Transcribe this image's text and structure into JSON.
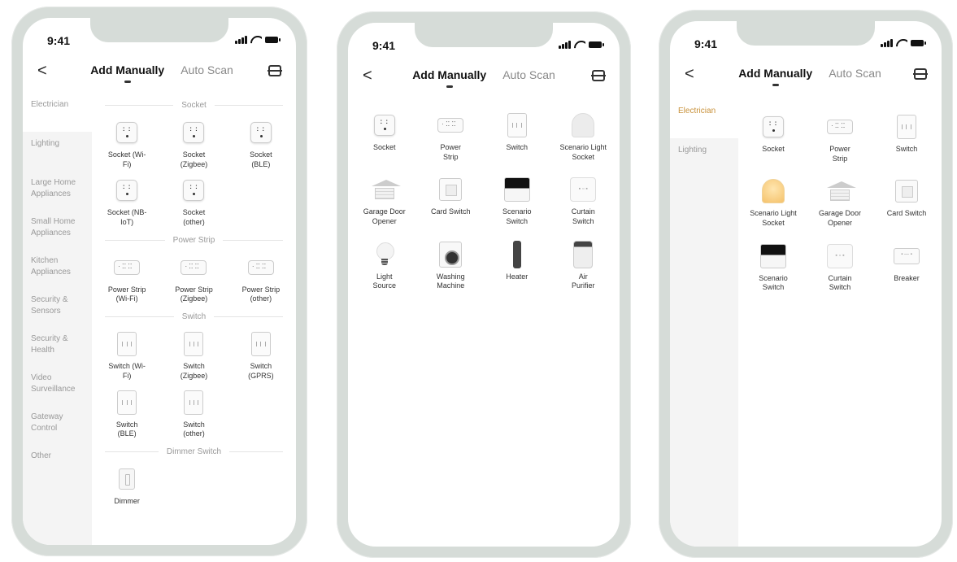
{
  "status": {
    "time": "9:41"
  },
  "nav": {
    "back": "<",
    "tab_manual": "Add Manually",
    "tab_scan": "Auto Scan"
  },
  "phone1": {
    "sidebar": [
      "Electrician",
      "Lighting",
      "Large Home Appliances",
      "Small Home Appliances",
      "Kitchen Appliances",
      "Security & Sensors",
      "Security & Health",
      "Video Surveillance",
      "Gateway Control",
      "Other"
    ],
    "sections": [
      {
        "title": "Socket",
        "items": [
          "Socket (Wi-Fi)",
          "Socket (Zigbee)",
          "Socket (BLE)",
          "Socket (NB-IoT)",
          "Socket (other)"
        ]
      },
      {
        "title": "Power Strip",
        "items": [
          "Power Strip (Wi-Fi)",
          "Power Strip (Zigbee)",
          "Power Strip (other)"
        ]
      },
      {
        "title": "Switch",
        "items": [
          "Switch (Wi-Fi)",
          "Switch (Zigbee)",
          "Switch (GPRS)",
          "Switch (BLE)",
          "Switch (other)"
        ]
      },
      {
        "title": "Dimmer Switch",
        "items": [
          "Dimmer"
        ]
      }
    ]
  },
  "phone2": {
    "items": [
      "Socket",
      "Power Strip",
      "Switch",
      "Scenario Light Socket",
      "Garage Door Opener",
      "Card Switch",
      "Scenario Switch",
      "Curtain Switch",
      "Light Source",
      "Washing Machine",
      "Heater",
      "Air Purifier"
    ]
  },
  "phone3": {
    "sidebar": [
      "Electrician",
      "Lighting"
    ],
    "items": [
      "Socket",
      "Power Strip",
      "Switch",
      "Scenario Light Socket",
      "Garage Door Opener",
      "Card Switch",
      "Scenario Switch",
      "Curtain Switch",
      "Breaker"
    ]
  },
  "colors": {
    "frame": "#d6dcd8",
    "active_sidebar": "#c8913a"
  }
}
